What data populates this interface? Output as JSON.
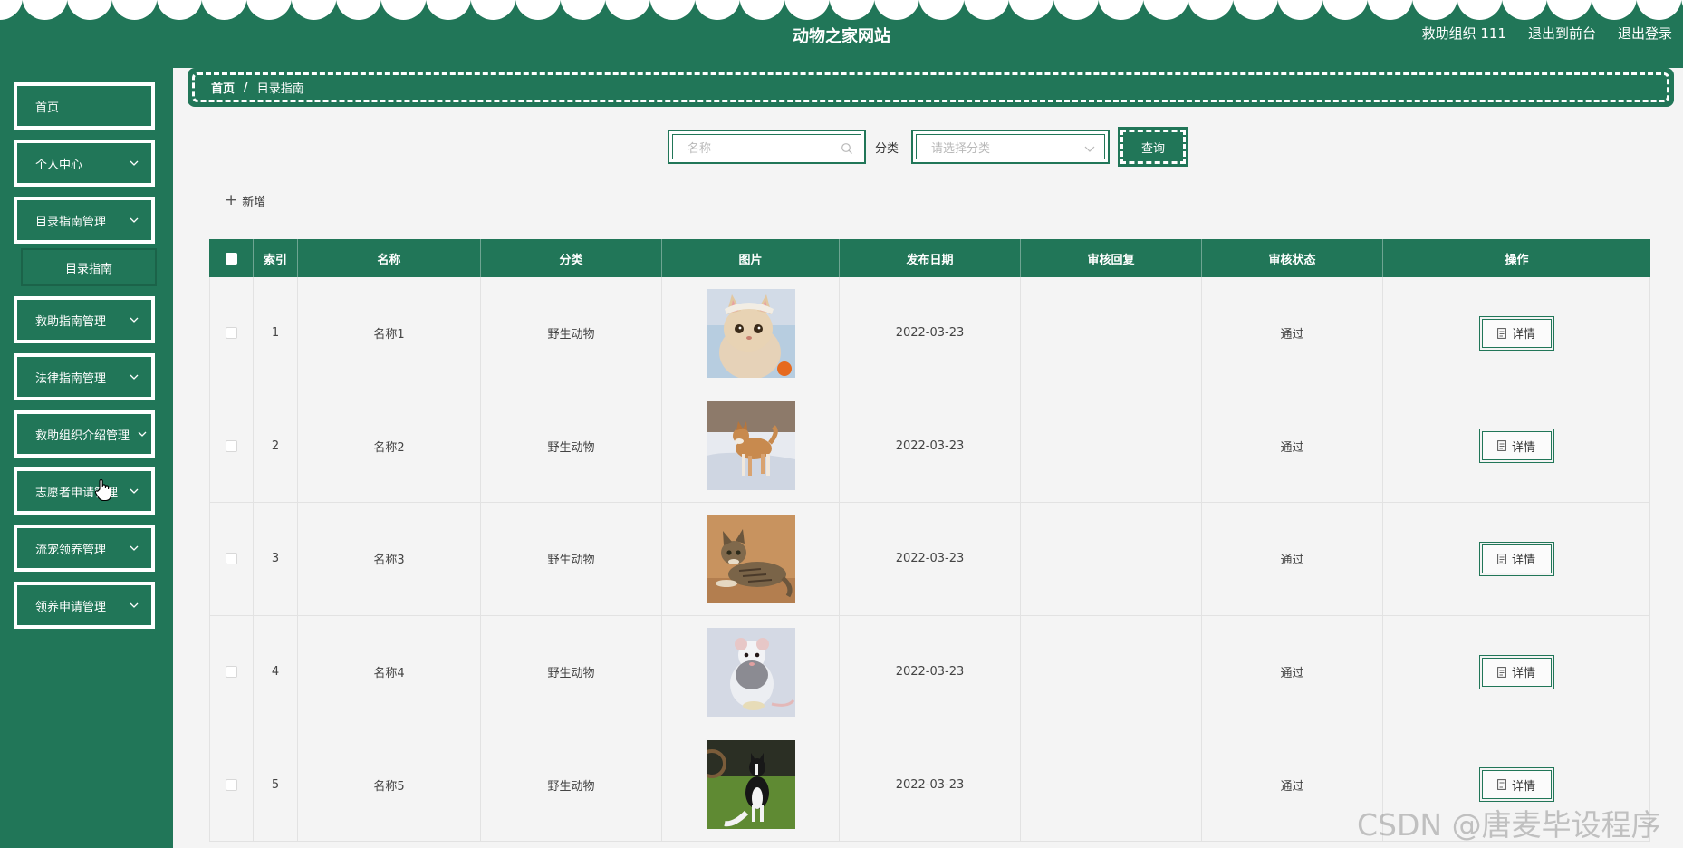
{
  "header": {
    "site_title": "动物之家网站",
    "user": "救助组织 111",
    "to_front": "退出到前台",
    "logout": "退出登录"
  },
  "sidebar": {
    "items": [
      {
        "label": "首页"
      },
      {
        "label": "个人中心"
      },
      {
        "label": "目录指南管理"
      },
      {
        "label": "救助指南管理"
      },
      {
        "label": "法律指南管理"
      },
      {
        "label": "救助组织介绍管理"
      },
      {
        "label": "志愿者申请管理"
      },
      {
        "label": "流宠领养管理"
      },
      {
        "label": "领养申请管理"
      }
    ],
    "submenu_label": "目录指南"
  },
  "breadcrumb": {
    "home": "首页",
    "separator": "/",
    "current": "目录指南"
  },
  "search": {
    "name_placeholder": "名称",
    "category_label": "分类",
    "category_placeholder": "请选择分类",
    "query_button": "查询"
  },
  "toolbar": {
    "add_label": "新增"
  },
  "table": {
    "headers": [
      "索引",
      "名称",
      "分类",
      "图片",
      "发布日期",
      "审核回复",
      "审核状态",
      "操作"
    ],
    "rows": [
      {
        "index": "1",
        "name": "名称1",
        "category": "野生动物",
        "image": "cat-with-headwear",
        "date": "2022-03-23",
        "reply": "",
        "status": "通过",
        "action": "详情"
      },
      {
        "index": "2",
        "name": "名称2",
        "category": "野生动物",
        "image": "shiba-dog-on-snow",
        "date": "2022-03-23",
        "reply": "",
        "status": "通过",
        "action": "详情"
      },
      {
        "index": "3",
        "name": "名称3",
        "category": "野生动物",
        "image": "tabby-cat-lying",
        "date": "2022-03-23",
        "reply": "",
        "status": "通过",
        "action": "详情"
      },
      {
        "index": "4",
        "name": "名称4",
        "category": "野生动物",
        "image": "white-rat",
        "date": "2022-03-23",
        "reply": "",
        "status": "通过",
        "action": "详情"
      },
      {
        "index": "5",
        "name": "名称5",
        "category": "野生动物",
        "image": "border-collie-on-grass",
        "date": "2022-03-23",
        "reply": "",
        "status": "通过",
        "action": "详情"
      }
    ]
  },
  "watermark": "CSDN @唐麦毕设程序",
  "colors": {
    "primary": "#217658",
    "background": "#f4f4f4"
  }
}
